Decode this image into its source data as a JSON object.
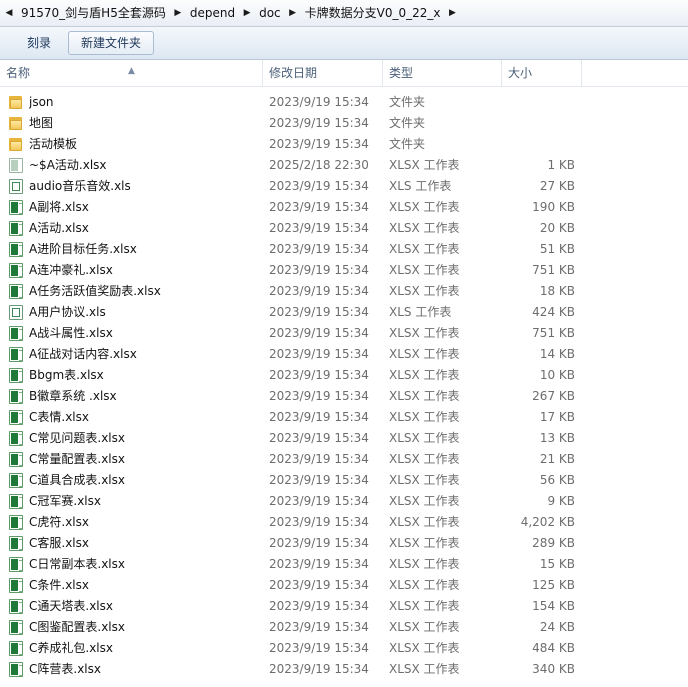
{
  "breadcrumb": [
    "91570_剑与盾H5全套源码",
    "depend",
    "doc",
    "卡牌数据分支V0_0_22_x"
  ],
  "toolbar": {
    "burn_label": "刻录",
    "new_folder_label": "新建文件夹"
  },
  "columns": {
    "name": "名称",
    "date": "修改日期",
    "type": "类型",
    "size": "大小"
  },
  "files": [
    {
      "icon": "folder-icon",
      "name": "json",
      "date": "2023/9/19 15:34",
      "type": "文件夹",
      "size": ""
    },
    {
      "icon": "folder-icon",
      "name": "地图",
      "date": "2023/9/19 15:34",
      "type": "文件夹",
      "size": ""
    },
    {
      "icon": "folder-icon",
      "name": "活动模板",
      "date": "2023/9/19 15:34",
      "type": "文件夹",
      "size": ""
    },
    {
      "icon": "temp-excel-icon",
      "name": "~$A活动.xlsx",
      "date": "2025/2/18 22:30",
      "type": "XLSX 工作表",
      "size": "1 KB"
    },
    {
      "icon": "xls-icon",
      "name": "audio音乐音效.xls",
      "date": "2023/9/19 15:34",
      "type": "XLS 工作表",
      "size": "27 KB"
    },
    {
      "icon": "xlsx-icon",
      "name": "A副将.xlsx",
      "date": "2023/9/19 15:34",
      "type": "XLSX 工作表",
      "size": "190 KB"
    },
    {
      "icon": "xlsx-icon",
      "name": "A活动.xlsx",
      "date": "2023/9/19 15:34",
      "type": "XLSX 工作表",
      "size": "20 KB"
    },
    {
      "icon": "xlsx-icon",
      "name": "A进阶目标任务.xlsx",
      "date": "2023/9/19 15:34",
      "type": "XLSX 工作表",
      "size": "51 KB"
    },
    {
      "icon": "xlsx-icon",
      "name": "A连冲豪礼.xlsx",
      "date": "2023/9/19 15:34",
      "type": "XLSX 工作表",
      "size": "751 KB"
    },
    {
      "icon": "xlsx-icon",
      "name": "A任务活跃值奖励表.xlsx",
      "date": "2023/9/19 15:34",
      "type": "XLSX 工作表",
      "size": "18 KB"
    },
    {
      "icon": "xls-icon",
      "name": "A用户协议.xls",
      "date": "2023/9/19 15:34",
      "type": "XLS 工作表",
      "size": "424 KB"
    },
    {
      "icon": "xlsx-icon",
      "name": "A战斗属性.xlsx",
      "date": "2023/9/19 15:34",
      "type": "XLSX 工作表",
      "size": "751 KB"
    },
    {
      "icon": "xlsx-icon",
      "name": "A征战对话内容.xlsx",
      "date": "2023/9/19 15:34",
      "type": "XLSX 工作表",
      "size": "14 KB"
    },
    {
      "icon": "xlsx-icon",
      "name": "Bbgm表.xlsx",
      "date": "2023/9/19 15:34",
      "type": "XLSX 工作表",
      "size": "10 KB"
    },
    {
      "icon": "xlsx-icon",
      "name": "B徽章系统 .xlsx",
      "date": "2023/9/19 15:34",
      "type": "XLSX 工作表",
      "size": "267 KB"
    },
    {
      "icon": "xlsx-icon",
      "name": "C表情.xlsx",
      "date": "2023/9/19 15:34",
      "type": "XLSX 工作表",
      "size": "17 KB"
    },
    {
      "icon": "xlsx-icon",
      "name": "C常见问题表.xlsx",
      "date": "2023/9/19 15:34",
      "type": "XLSX 工作表",
      "size": "13 KB"
    },
    {
      "icon": "xlsx-icon",
      "name": "C常量配置表.xlsx",
      "date": "2023/9/19 15:34",
      "type": "XLSX 工作表",
      "size": "21 KB"
    },
    {
      "icon": "xlsx-icon",
      "name": "C道具合成表.xlsx",
      "date": "2023/9/19 15:34",
      "type": "XLSX 工作表",
      "size": "56 KB"
    },
    {
      "icon": "xlsx-icon",
      "name": "C冠军赛.xlsx",
      "date": "2023/9/19 15:34",
      "type": "XLSX 工作表",
      "size": "9 KB"
    },
    {
      "icon": "xlsx-icon",
      "name": "C虎符.xlsx",
      "date": "2023/9/19 15:34",
      "type": "XLSX 工作表",
      "size": "4,202 KB"
    },
    {
      "icon": "xlsx-icon",
      "name": "C客服.xlsx",
      "date": "2023/9/19 15:34",
      "type": "XLSX 工作表",
      "size": "289 KB"
    },
    {
      "icon": "xlsx-icon",
      "name": "C日常副本表.xlsx",
      "date": "2023/9/19 15:34",
      "type": "XLSX 工作表",
      "size": "15 KB"
    },
    {
      "icon": "xlsx-icon",
      "name": "C条件.xlsx",
      "date": "2023/9/19 15:34",
      "type": "XLSX 工作表",
      "size": "125 KB"
    },
    {
      "icon": "xlsx-icon",
      "name": "C通天塔表.xlsx",
      "date": "2023/9/19 15:34",
      "type": "XLSX 工作表",
      "size": "154 KB"
    },
    {
      "icon": "xlsx-icon",
      "name": "C图鉴配置表.xlsx",
      "date": "2023/9/19 15:34",
      "type": "XLSX 工作表",
      "size": "24 KB"
    },
    {
      "icon": "xlsx-icon",
      "name": "C养成礼包.xlsx",
      "date": "2023/9/19 15:34",
      "type": "XLSX 工作表",
      "size": "484 KB"
    },
    {
      "icon": "xlsx-icon",
      "name": "C阵营表.xlsx",
      "date": "2023/9/19 15:34",
      "type": "XLSX 工作表",
      "size": "340 KB"
    }
  ]
}
